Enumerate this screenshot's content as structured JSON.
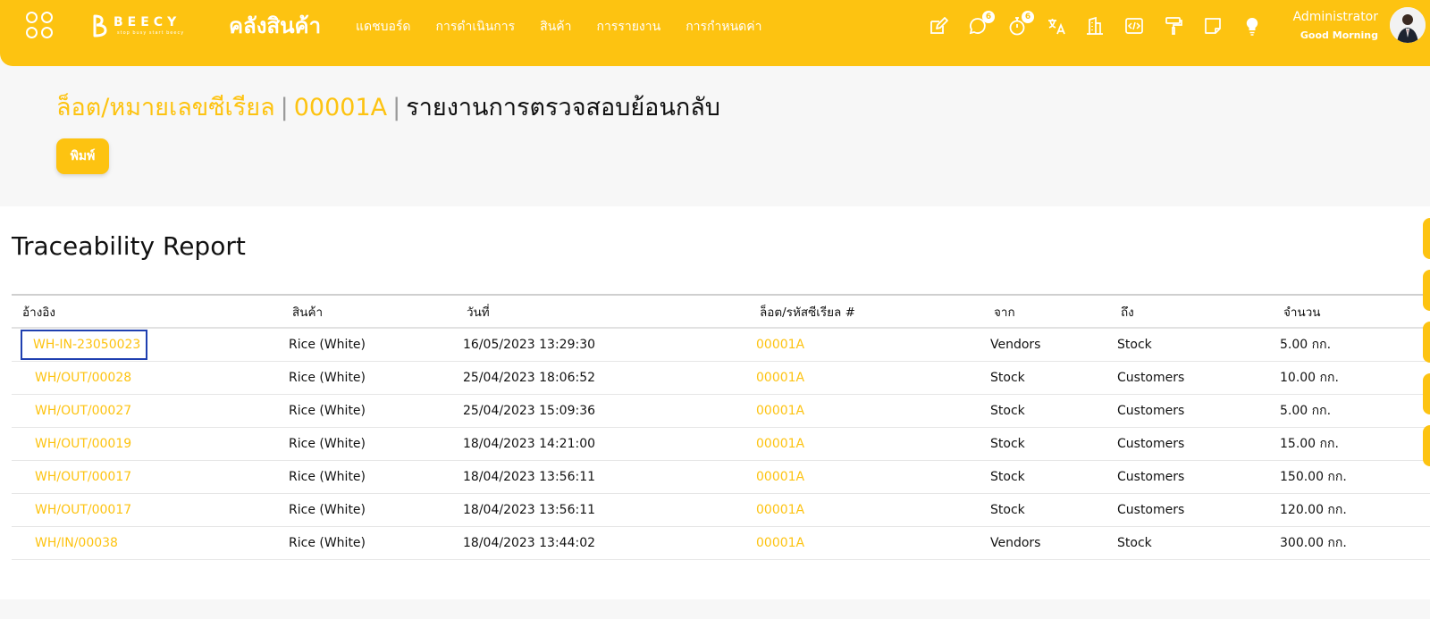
{
  "header": {
    "brand_name": "BEECY",
    "brand_slogan": "stop busy start beecy",
    "app_title": "คลังสินค้า",
    "nav": [
      {
        "label": "แดชบอร์ด"
      },
      {
        "label": "การดำเนินการ"
      },
      {
        "label": "สินค้า"
      },
      {
        "label": "การรายงาน"
      },
      {
        "label": "การกำหนดค่า"
      }
    ],
    "tools": {
      "chat_badge": "6",
      "timer_badge": "6"
    },
    "user": {
      "name": "Administrator",
      "greeting": "Good Morning"
    }
  },
  "breadcrumb": {
    "items": [
      "ล็อต/หมายเลขซีเรียล",
      "00001A"
    ],
    "separator": "|",
    "current": "รายงานการตรวจสอบย้อนกลับ"
  },
  "actions": {
    "print_label": "พิมพ์"
  },
  "report": {
    "title": "Traceability Report",
    "columns": [
      "อ้างอิง",
      "สินค้า",
      "วันที่",
      "ล็อต/รหัสซีเรียล #",
      "จาก",
      "ถึง",
      "จำนวน"
    ],
    "rows": [
      {
        "ref": "WH-IN-23050023",
        "product": "Rice (White)",
        "date": "16/05/2023 13:29:30",
        "lot": "00001A",
        "from": "Vendors",
        "to": "Stock",
        "qty": "5.00 กก."
      },
      {
        "ref": "WH/OUT/00028",
        "product": "Rice (White)",
        "date": "25/04/2023 18:06:52",
        "lot": "00001A",
        "from": "Stock",
        "to": "Customers",
        "qty": "10.00 กก."
      },
      {
        "ref": "WH/OUT/00027",
        "product": "Rice (White)",
        "date": "25/04/2023 15:09:36",
        "lot": "00001A",
        "from": "Stock",
        "to": "Customers",
        "qty": "5.00 กก."
      },
      {
        "ref": "WH/OUT/00019",
        "product": "Rice (White)",
        "date": "18/04/2023 14:21:00",
        "lot": "00001A",
        "from": "Stock",
        "to": "Customers",
        "qty": "15.00 กก."
      },
      {
        "ref": "WH/OUT/00017",
        "product": "Rice (White)",
        "date": "18/04/2023 13:56:11",
        "lot": "00001A",
        "from": "Stock",
        "to": "Customers",
        "qty": "150.00 กก."
      },
      {
        "ref": "WH/OUT/00017",
        "product": "Rice (White)",
        "date": "18/04/2023 13:56:11",
        "lot": "00001A",
        "from": "Stock",
        "to": "Customers",
        "qty": "120.00 กก."
      },
      {
        "ref": "WH/IN/00038",
        "product": "Rice (White)",
        "date": "18/04/2023 13:44:02",
        "lot": "00001A",
        "from": "Vendors",
        "to": "Stock",
        "qty": "300.00 กก."
      }
    ]
  },
  "colors": {
    "accent": "#fdc311",
    "focus_outline": "#1f3fb0"
  }
}
